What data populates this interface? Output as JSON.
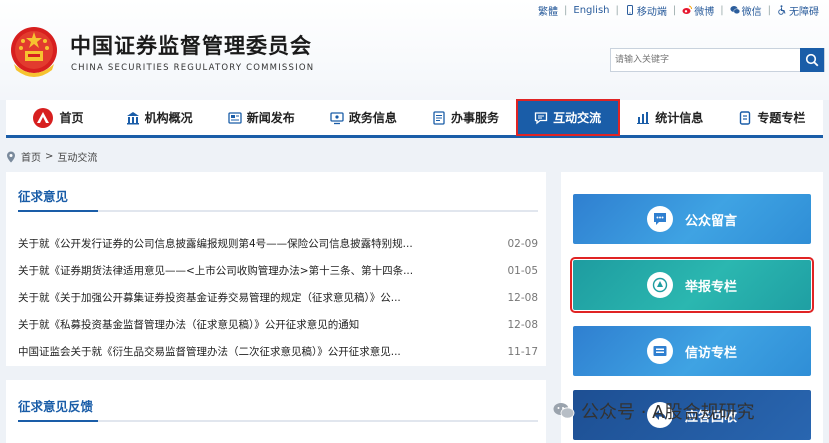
{
  "header": {
    "title_cn": "中国证券监督管理委员会",
    "title_en": "CHINA SECURITIES REGULATORY COMMISSION"
  },
  "toplinks": {
    "traditional": "繁體",
    "english": "English",
    "mobile": "移动端",
    "weibo": "微博",
    "wechat": "微信",
    "accessible": "无障碍"
  },
  "search": {
    "placeholder": "请输入关键字"
  },
  "nav": {
    "items": [
      {
        "label": "首页",
        "icon": "csrc-logo-icon"
      },
      {
        "label": "机构概况",
        "icon": "building-icon"
      },
      {
        "label": "新闻发布",
        "icon": "newspaper-icon"
      },
      {
        "label": "政务信息",
        "icon": "monitor-icon"
      },
      {
        "label": "办事服务",
        "icon": "document-icon"
      },
      {
        "label": "互动交流",
        "icon": "chat-icon"
      },
      {
        "label": "统计信息",
        "icon": "bar-chart-icon"
      },
      {
        "label": "专题专栏",
        "icon": "book-icon"
      }
    ],
    "active_index": 5
  },
  "breadcrumb": {
    "home": "首页",
    "sep": ">",
    "current": "互动交流"
  },
  "consult": {
    "title": "征求意见",
    "items": [
      {
        "title": "关于就《公开发行证券的公司信息披露编报规则第4号——保险公司信息披露特别规...",
        "date": "02-09"
      },
      {
        "title": "关于就《证券期货法律适用意见——<上市公司收购管理办法>第十三条、第十四条...",
        "date": "01-05"
      },
      {
        "title": "关于就《关于加强公开募集证券投资基金证券交易管理的规定（征求意见稿）》公...",
        "date": "12-08"
      },
      {
        "title": "关于就《私募投资基金监督管理办法（征求意见稿）》公开征求意见的通知",
        "date": "12-08"
      },
      {
        "title": "中国证监会关于就《衍生品交易监督管理办法（二次征求意见稿）》公开征求意见...",
        "date": "11-17"
      }
    ]
  },
  "feedback": {
    "title": "征求意见反馈"
  },
  "side_buttons": [
    {
      "label": "公众留言",
      "icon": "speech-bubble-icon"
    },
    {
      "label": "举报专栏",
      "icon": "emblem-icon"
    },
    {
      "label": "信访专栏",
      "icon": "inbox-icon"
    },
    {
      "label": "应答回收",
      "icon": "reply-icon"
    }
  ],
  "watermark": {
    "text": "公众号 · A股合规研究"
  },
  "colors": {
    "primary": "#1a5da8",
    "highlight": "#e02424",
    "teal": "#2bb7b0"
  }
}
